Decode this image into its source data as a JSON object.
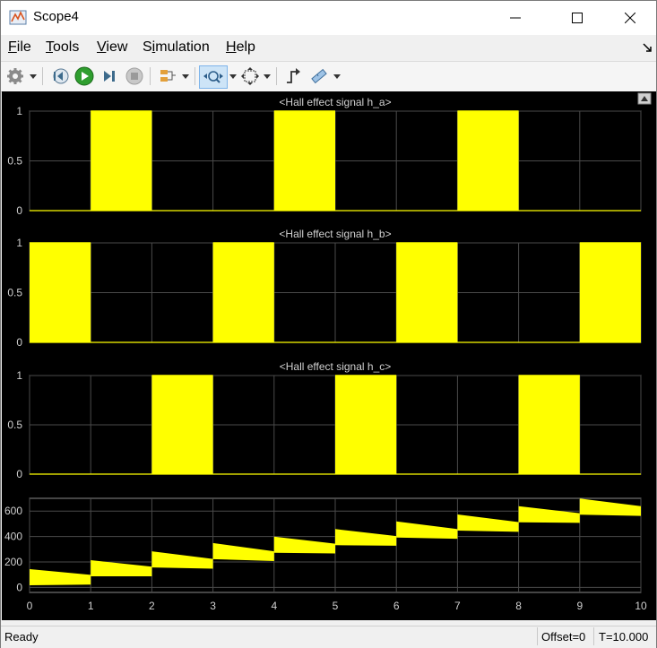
{
  "window": {
    "title": "Scope4"
  },
  "menu": [
    {
      "label": "File",
      "mnemonic": "F",
      "rest": "ile"
    },
    {
      "label": "Tools",
      "mnemonic": "T",
      "rest": "ools"
    },
    {
      "label": "View",
      "mnemonic": "V",
      "rest": "iew"
    },
    {
      "label": "Simulation",
      "mnemonic": "i",
      "pre": "S",
      "rest": "mulation"
    },
    {
      "label": "Help",
      "mnemonic": "H",
      "rest": "elp"
    }
  ],
  "toolbar_icons": [
    "settings-icon",
    "step-back-icon",
    "run-icon",
    "step-forward-icon",
    "stop-icon",
    "signal-select-icon",
    "zoom-icon",
    "fit-to-view-icon",
    "triggers-icon",
    "measurements-icon"
  ],
  "colors": {
    "plot_bg": "#000000",
    "signal": "#ffff00",
    "axes_bg": "#1e1e1e",
    "grid": "#4a4a4a"
  },
  "status": {
    "ready": "Ready",
    "offset": "Offset=0",
    "time": "T=10.000"
  },
  "chart_data": [
    {
      "type": "line",
      "title": "<Hall effect signal h_a>",
      "xlim": [
        0,
        10
      ],
      "ylim": [
        0,
        1
      ],
      "yticks": [
        "0",
        "0.5",
        "1"
      ],
      "high_intervals": [
        [
          1,
          2
        ],
        [
          4,
          5
        ],
        [
          7,
          8
        ]
      ],
      "grid": true
    },
    {
      "type": "line",
      "title": "<Hall effect signal h_b>",
      "xlim": [
        0,
        10
      ],
      "ylim": [
        0,
        1
      ],
      "yticks": [
        "0",
        "0.5",
        "1"
      ],
      "high_intervals": [
        [
          0,
          1
        ],
        [
          3,
          4
        ],
        [
          6,
          7
        ],
        [
          9,
          10
        ]
      ],
      "grid": true
    },
    {
      "type": "line",
      "title": "<Hall effect signal h_c>",
      "xlim": [
        0,
        10
      ],
      "ylim": [
        0,
        1
      ],
      "yticks": [
        "0",
        "0.5",
        "1"
      ],
      "high_intervals": [
        [
          2,
          3
        ],
        [
          5,
          6
        ],
        [
          8,
          9
        ]
      ],
      "grid": true
    },
    {
      "type": "line",
      "title": "",
      "xlim": [
        0,
        10
      ],
      "ylim": [
        -40,
        700
      ],
      "yticks": [
        "0",
        "200",
        "400",
        "600"
      ],
      "ytick_values": [
        0,
        200,
        400,
        600
      ],
      "xticks": [
        "0",
        "1",
        "2",
        "3",
        "4",
        "5",
        "6",
        "7",
        "8",
        "9",
        "10"
      ],
      "grid": true,
      "steps": [
        {
          "x": [
            0,
            1
          ],
          "start": 80,
          "end": 60
        },
        {
          "x": [
            1,
            2
          ],
          "start": 150,
          "end": 125
        },
        {
          "x": [
            2,
            3
          ],
          "start": 220,
          "end": 185
        },
        {
          "x": [
            3,
            4
          ],
          "start": 285,
          "end": 245
        },
        {
          "x": [
            4,
            5
          ],
          "start": 335,
          "end": 305
        },
        {
          "x": [
            5,
            6
          ],
          "start": 395,
          "end": 365
        },
        {
          "x": [
            6,
            7
          ],
          "start": 455,
          "end": 420
        },
        {
          "x": [
            7,
            8
          ],
          "start": 510,
          "end": 475
        },
        {
          "x": [
            8,
            9
          ],
          "start": 575,
          "end": 545
        },
        {
          "x": [
            9,
            10
          ],
          "start": 635,
          "end": 600
        }
      ]
    }
  ]
}
